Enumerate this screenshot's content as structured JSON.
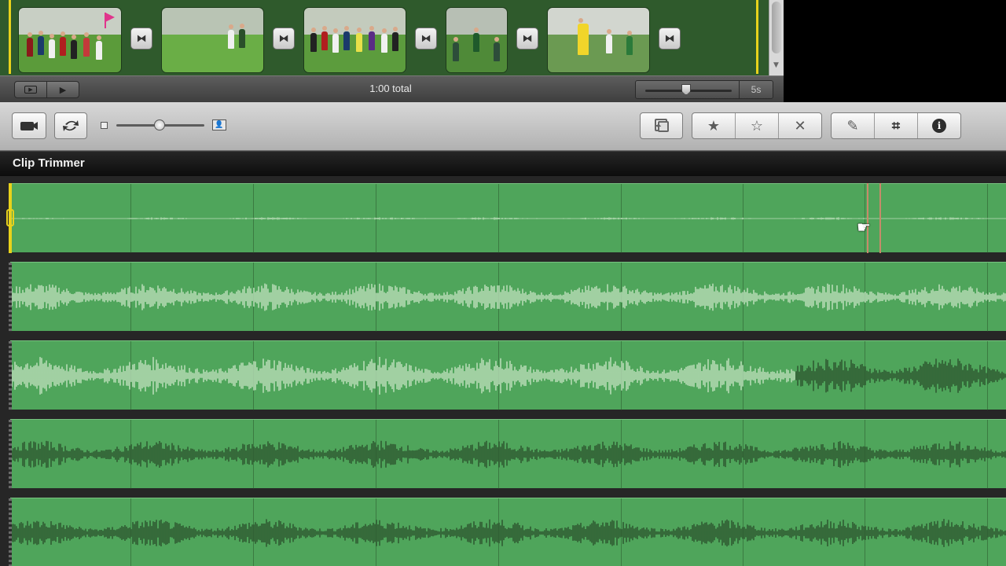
{
  "project": {
    "total_label": "1:00 total",
    "zoom_value": "5s",
    "transition_icon": "⧓",
    "thumbnails": [
      {
        "name": "clip-1",
        "sky": "#c8cfc4",
        "grass": "#5b9b3a"
      },
      {
        "name": "clip-2",
        "sky": "#b9c4b4",
        "grass": "#6aae46"
      },
      {
        "name": "clip-3",
        "sky": "#c3cbbd",
        "grass": "#5c9c3d"
      },
      {
        "name": "clip-4",
        "sky": "#b7bfb4",
        "grass": "#4f8a38"
      },
      {
        "name": "clip-5",
        "sky": "#d2d6cf",
        "grass": "#6b9a52"
      }
    ]
  },
  "toolbar": {
    "camera_icon": "camera-icon",
    "swap_icon": "swap-icon",
    "favorite_star": "★",
    "unfavorite_star": "☆",
    "reject_x": "✕",
    "dropper": "✎",
    "crop": "⌗",
    "info": "i"
  },
  "trimmer": {
    "title": "Clip Trimmer",
    "track_color": "#4fa55b",
    "light_wave_color": "#b6dbb5",
    "dark_wave_color": "#2f5b32",
    "selection_marker_color": "#e8d21c"
  }
}
